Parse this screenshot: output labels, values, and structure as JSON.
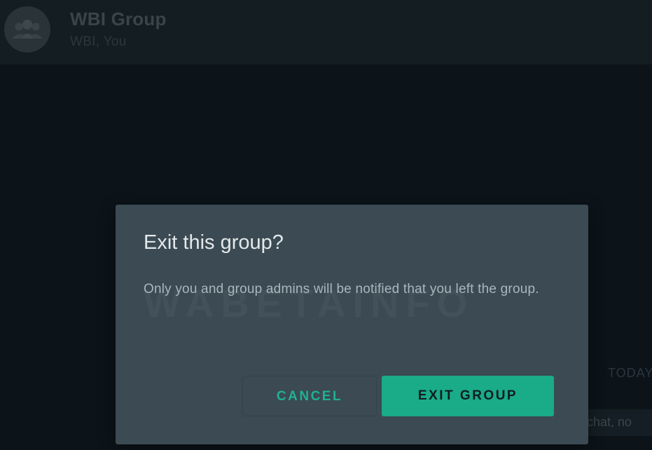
{
  "header": {
    "group_name": "WBI Group",
    "members": "WBI, You"
  },
  "chat": {
    "date_chip": "TODAY",
    "system_message": "chat, no"
  },
  "dialog": {
    "watermark": "WABETAINFO",
    "title": "Exit this group?",
    "body": "Only you and group admins will be notified that you left the group.",
    "cancel_label": "CANCEL",
    "exit_label": "EXIT GROUP"
  },
  "colors": {
    "accent": "#1aab89",
    "dialog_bg": "#3b4a53",
    "app_bg": "#0b141a"
  },
  "icons": {
    "avatar": "group-icon"
  }
}
